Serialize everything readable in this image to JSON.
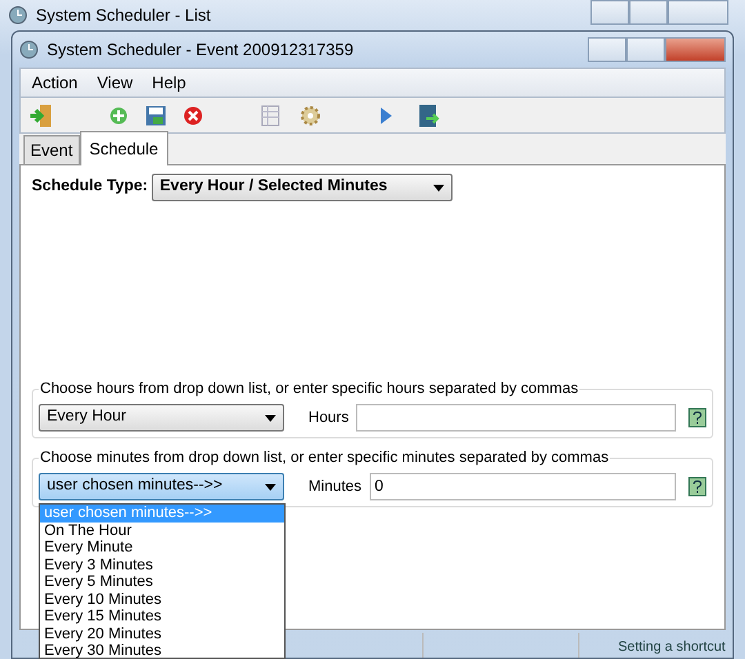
{
  "background_window": {
    "title": "System Scheduler - List"
  },
  "window": {
    "title": "System Scheduler - Event 200912317359"
  },
  "menu": [
    "Action",
    "View",
    "Help"
  ],
  "tabs": [
    {
      "label": "Event",
      "selected": false
    },
    {
      "label": "Schedule",
      "selected": true
    }
  ],
  "schedule_type": {
    "label": "Schedule Type:",
    "value": "Every Hour / Selected Minutes"
  },
  "hours_group": {
    "legend": "Choose hours from drop down list, or enter specific hours separated by commas",
    "select_value": "Every Hour",
    "field_label": "Hours"
  },
  "minutes_group": {
    "legend": "Choose minutes from drop down list, or enter specific minutes separated by commas",
    "select_value": "user chosen minutes-->>",
    "field_label": "Minutes",
    "value": "0"
  },
  "minutes_dropdown": [
    {
      "label": "user chosen minutes-->>",
      "selected": true
    },
    {
      "label": "On The Hour",
      "selected": false
    },
    {
      "label": "Every Minute",
      "selected": false
    },
    {
      "label": "Every 3 Minutes",
      "selected": false
    },
    {
      "label": "Every 5 Minutes",
      "selected": false
    },
    {
      "label": "Every 10 Minutes",
      "selected": false
    },
    {
      "label": "Every 15 Minutes",
      "selected": false
    },
    {
      "label": "Every 20 Minutes",
      "selected": false
    },
    {
      "label": "Every 30 Minutes",
      "selected": false
    }
  ],
  "background_text": "Setting a shortcut"
}
